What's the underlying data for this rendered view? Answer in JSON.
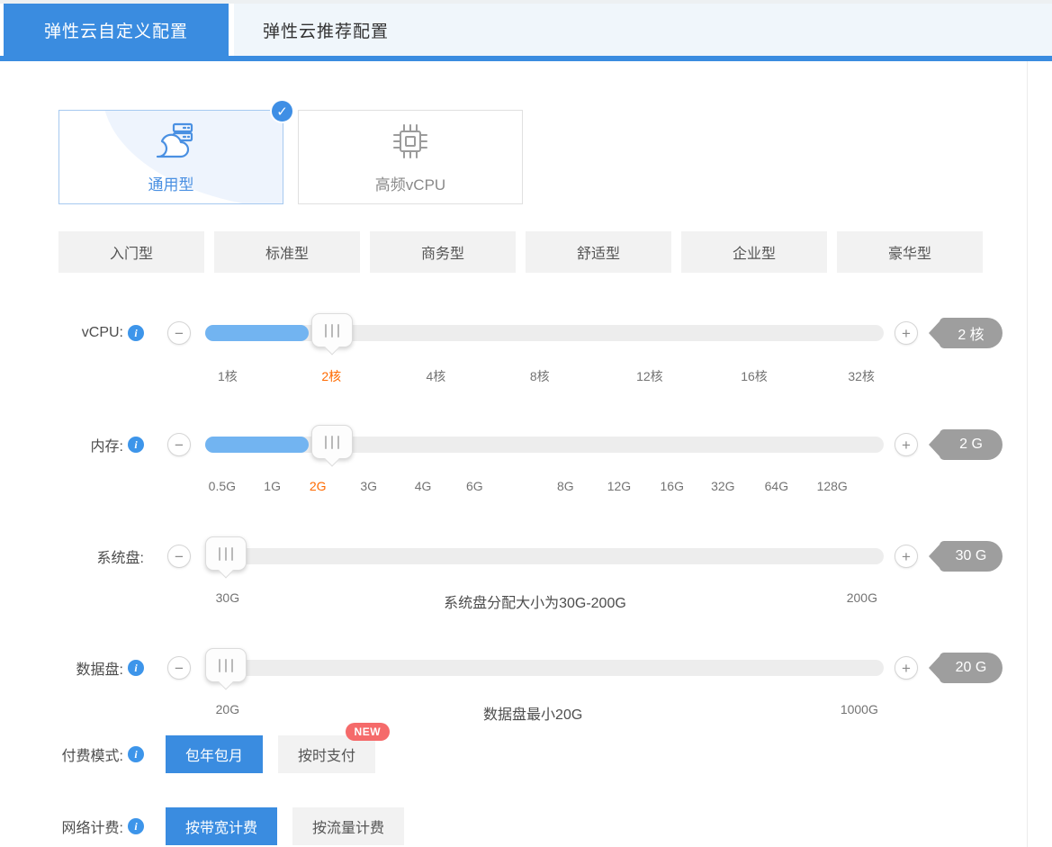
{
  "colors": {
    "accent": "#3a8ce0",
    "slider_fill": "#72b4f1",
    "active_tick": "#ff6a00",
    "badge_gray": "#9e9e9e",
    "new_red": "#f56a6a"
  },
  "tabs": [
    {
      "label": "弹性云自定义配置",
      "active": true
    },
    {
      "label": "弹性云推荐配置",
      "active": false
    }
  ],
  "cards": [
    {
      "label": "通用型",
      "icon": "cloud-server-icon",
      "selected": true
    },
    {
      "label": "高频vCPU",
      "icon": "cpu-chip-icon",
      "selected": false
    }
  ],
  "tiers": [
    "入门型",
    "标准型",
    "商务型",
    "舒适型",
    "企业型",
    "豪华型"
  ],
  "controls": {
    "decrease": "−",
    "increase": "+",
    "info": "i",
    "check": "✓"
  },
  "vcpu": {
    "label": "vCPU:",
    "badge": "2 核",
    "ticks": [
      "1核",
      "2核",
      "4核",
      "8核",
      "12核",
      "16核",
      "32核"
    ],
    "selected_tick": "2核"
  },
  "memory": {
    "label": "内存:",
    "badge": "2 G",
    "ticks": [
      "0.5G",
      "1G",
      "2G",
      "3G",
      "4G",
      "6G",
      "8G",
      "12G",
      "16G",
      "32G",
      "64G",
      "128G"
    ],
    "selected_tick": "2G"
  },
  "system_disk": {
    "label": "系统盘:",
    "badge": "30 G",
    "min": "30G",
    "hint": "系统盘分配大小为30G-200G",
    "max": "200G"
  },
  "data_disk": {
    "label": "数据盘:",
    "badge": "20 G",
    "min": "20G",
    "hint": "数据盘最小20G",
    "max": "1000G"
  },
  "payment": {
    "label": "付费模式:",
    "options": [
      "包年包月",
      "按时支付"
    ],
    "selected": "包年包月",
    "new_badge": "NEW"
  },
  "network": {
    "label": "网络计费:",
    "options": [
      "按带宽计费",
      "按流量计费"
    ],
    "selected": "按带宽计费"
  }
}
